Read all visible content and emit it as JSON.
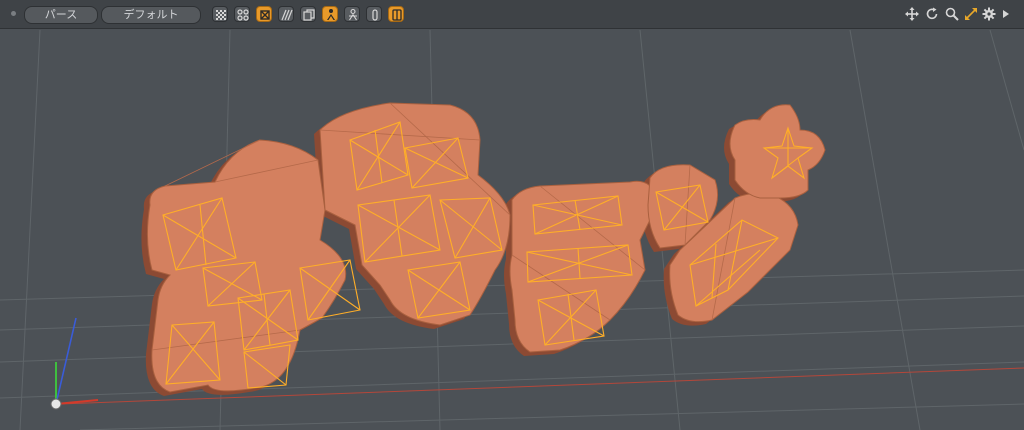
{
  "toolbar": {
    "view_mode": "パース",
    "shading_mode": "デフォルト",
    "buttons": [
      {
        "name": "checker-icon",
        "active": false
      },
      {
        "name": "grid-dots-icon",
        "active": false
      },
      {
        "name": "wireframe-box-icon",
        "active": true
      },
      {
        "name": "hatch-icon",
        "active": false
      },
      {
        "name": "copy-icon",
        "active": false
      },
      {
        "name": "person-icon",
        "active": true
      },
      {
        "name": "person-outline-icon",
        "active": false
      },
      {
        "name": "capsule-icon",
        "active": false
      },
      {
        "name": "book-icon",
        "active": true
      }
    ],
    "right_icons": [
      "move-view-icon",
      "rotate-view-icon",
      "zoom-view-icon",
      "maximize-icon",
      "settings-icon",
      "expand-arrow-icon"
    ]
  },
  "colors": {
    "viewport_bg": "#4c5156",
    "mesh_fill": "#d4805f",
    "mesh_shadow": "#8c4a33",
    "wire": "#ffae28",
    "accent": "#e89a2a",
    "axis_x": "#d43a2a",
    "axis_y": "#3fbf3f",
    "axis_z": "#3a5cd8"
  }
}
